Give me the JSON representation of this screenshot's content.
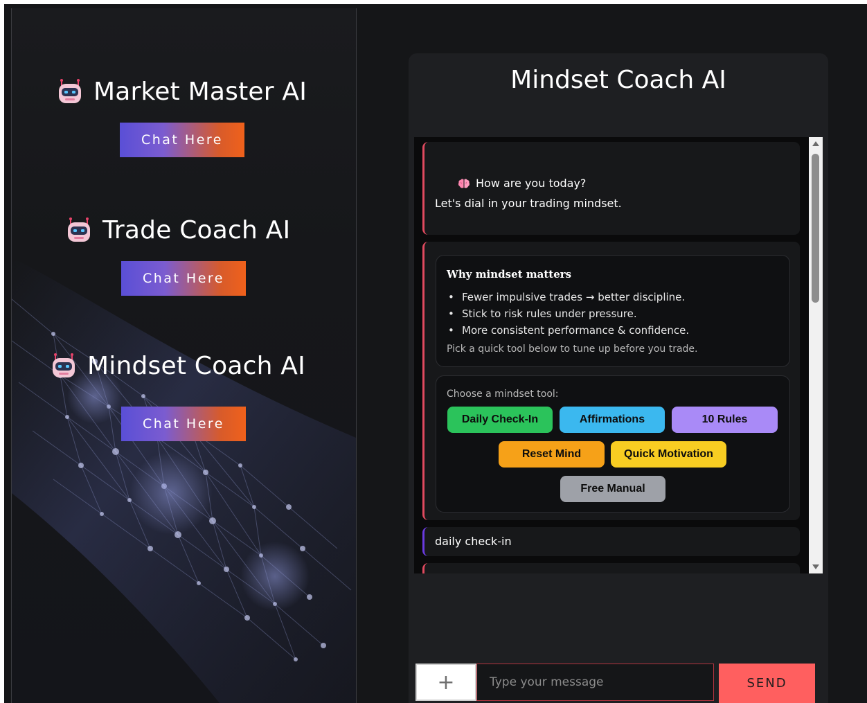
{
  "sidebar": {
    "bots": [
      {
        "title": "Market Master AI",
        "button": "Chat Here"
      },
      {
        "title": "Trade Coach AI",
        "button": "Chat Here"
      },
      {
        "title": "Mindset Coach AI",
        "button": "Chat Here"
      }
    ]
  },
  "coach": {
    "title": "Mindset Coach AI",
    "messages": {
      "greeting_line1": "How are you today?",
      "greeting_line2": "Let's dial in your trading mindset.",
      "why": {
        "title": "Why mindset matters",
        "items": [
          "Fewer impulsive trades → better discipline.",
          "Stick to risk rules under pressure.",
          "More consistent performance & confidence."
        ],
        "note": "Pick a quick tool below to tune up before you trade."
      },
      "tools": {
        "label": "Choose a mindset tool:",
        "buttons": [
          {
            "label": "Daily Check-In",
            "color": "#2bc35b"
          },
          {
            "label": "Affirmations",
            "color": "#3bb8ef"
          },
          {
            "label": "10 Rules",
            "color": "#a98af7"
          },
          {
            "label": "Reset Mind",
            "color": "#f6a118"
          },
          {
            "label": "Quick Motivation",
            "color": "#f8cd22"
          },
          {
            "label": "Free Manual",
            "color": "#9ea1a8"
          }
        ]
      },
      "user_reply": "daily check-in"
    }
  },
  "input": {
    "plus_label": "+",
    "placeholder": "Type your message",
    "send_label": "SEND"
  },
  "colors": {
    "accent_red": "#e04a5f",
    "accent_purple": "#6a3ae0",
    "send": "#ff5f5f"
  }
}
